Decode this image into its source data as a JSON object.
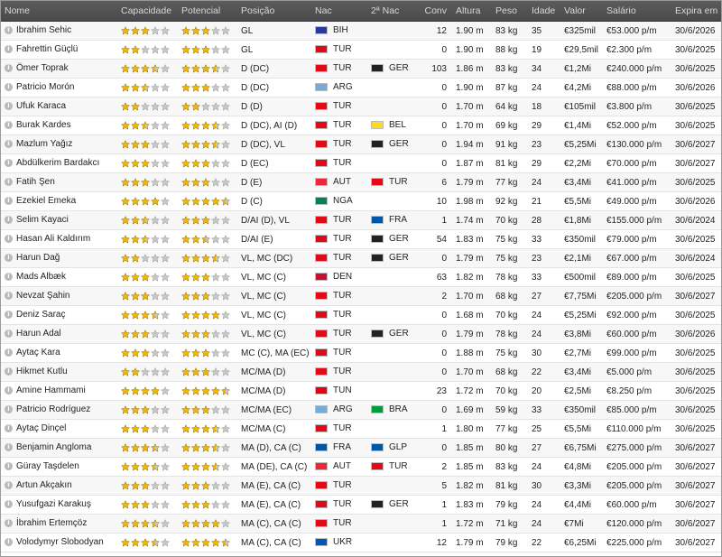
{
  "columns": {
    "nome": "Nome",
    "capacidade": "Capacidade",
    "potencial": "Potencial",
    "posicao": "Posição",
    "nac": "Nac",
    "nac2": "2ª Nac",
    "conv": "Conv",
    "altura": "Altura",
    "peso": "Peso",
    "idade": "Idade",
    "valor": "Valor",
    "salario": "Salário",
    "expira": "Expira em"
  },
  "flag_colors": {
    "BIH": "#2a3a9c",
    "TUR": "#e30a17",
    "GER": "#222222",
    "ARG": "#75aadb",
    "BEL": "#fdda24",
    "AUT": "#ed2939",
    "NGA": "#008751",
    "FRA": "#0055a4",
    "DEN": "#c8102e",
    "TUN": "#e70013",
    "BRA": "#009c3b",
    "GLP": "#0055a4",
    "UKR": "#0057b7"
  },
  "star_colors": {
    "full": "#f2b705",
    "empty": "#c7c7c7",
    "outline": "#8f6b00"
  },
  "players": [
    {
      "name": "Ibrahim Sehic",
      "cap": 3,
      "pot": 3,
      "pos": "GL",
      "nac": "BIH",
      "nac2": "",
      "conv": "12",
      "alt": "1.90 m",
      "peso": "83 kg",
      "idade": "35",
      "valor": "€325mil",
      "salario": "€53.000 p/m",
      "expira": "30/6/2026"
    },
    {
      "name": "Fahrettin Güçlü",
      "cap": 2,
      "pot": 3,
      "pos": "GL",
      "nac": "TUR",
      "nac2": "",
      "conv": "0",
      "alt": "1.90 m",
      "peso": "88 kg",
      "idade": "19",
      "valor": "€29,5mil",
      "salario": "€2.300 p/m",
      "expira": "30/6/2025"
    },
    {
      "name": "Ömer Toprak",
      "cap": 3.5,
      "pot": 3.5,
      "pos": "D (DC)",
      "nac": "TUR",
      "nac2": "GER",
      "conv": "103",
      "alt": "1.86 m",
      "peso": "83 kg",
      "idade": "34",
      "valor": "€1,2Mi",
      "salario": "€240.000 p/m",
      "expira": "30/6/2025"
    },
    {
      "name": "Patricio Morón",
      "cap": 2.5,
      "pot": 3,
      "pos": "D (DC)",
      "nac": "ARG",
      "nac2": "",
      "conv": "0",
      "alt": "1.90 m",
      "peso": "87 kg",
      "idade": "24",
      "valor": "€4,2Mi",
      "salario": "€88.000 p/m",
      "expira": "30/6/2026"
    },
    {
      "name": "Ufuk Karaca",
      "cap": 2,
      "pot": 2,
      "pos": "D (D)",
      "nac": "TUR",
      "nac2": "",
      "conv": "0",
      "alt": "1.70 m",
      "peso": "64 kg",
      "idade": "18",
      "valor": "€105mil",
      "salario": "€3.800 p/m",
      "expira": "30/6/2025"
    },
    {
      "name": "Burak Kardes",
      "cap": 2.5,
      "pot": 3.5,
      "pos": "D (DC), AI (D)",
      "nac": "TUR",
      "nac2": "BEL",
      "conv": "0",
      "alt": "1.70 m",
      "peso": "69 kg",
      "idade": "29",
      "valor": "€1,4Mi",
      "salario": "€52.000 p/m",
      "expira": "30/6/2025"
    },
    {
      "name": "Mazlum Yağız",
      "cap": 3,
      "pot": 3.5,
      "pos": "D (DC), VL",
      "nac": "TUR",
      "nac2": "GER",
      "conv": "0",
      "alt": "1.94 m",
      "peso": "91 kg",
      "idade": "23",
      "valor": "€5,25Mi",
      "salario": "€130.000 p/m",
      "expira": "30/6/2027"
    },
    {
      "name": "Abdülkerim Bardakcı",
      "cap": 3,
      "pot": 3,
      "pos": "D (EC)",
      "nac": "TUR",
      "nac2": "",
      "conv": "0",
      "alt": "1.87 m",
      "peso": "81 kg",
      "idade": "29",
      "valor": "€2,2Mi",
      "salario": "€70.000 p/m",
      "expira": "30/6/2027"
    },
    {
      "name": "Fatih Şen",
      "cap": 3,
      "pot": 3,
      "pos": "D (E)",
      "nac": "AUT",
      "nac2": "TUR",
      "conv": "6",
      "alt": "1.79 m",
      "peso": "77 kg",
      "idade": "24",
      "valor": "€3,4Mi",
      "salario": "€41.000 p/m",
      "expira": "30/6/2025"
    },
    {
      "name": "Ezekiel Emeka",
      "cap": 4,
      "pot": 4.5,
      "pos": "D (C)",
      "nac": "NGA",
      "nac2": "",
      "conv": "10",
      "alt": "1.98 m",
      "peso": "92 kg",
      "idade": "21",
      "valor": "€5,5Mi",
      "salario": "€49.000 p/m",
      "expira": "30/6/2026"
    },
    {
      "name": "Selim Kayaci",
      "cap": 2.5,
      "pot": 3,
      "pos": "D/AI (D), VL",
      "nac": "TUR",
      "nac2": "FRA",
      "conv": "1",
      "alt": "1.74 m",
      "peso": "70 kg",
      "idade": "28",
      "valor": "€1,8Mi",
      "salario": "€155.000 p/m",
      "expira": "30/6/2024"
    },
    {
      "name": "Hasan Ali Kaldırım",
      "cap": 2.5,
      "pot": 2.5,
      "pos": "D/AI (E)",
      "nac": "TUR",
      "nac2": "GER",
      "conv": "54",
      "alt": "1.83 m",
      "peso": "75 kg",
      "idade": "33",
      "valor": "€350mil",
      "salario": "€79.000 p/m",
      "expira": "30/6/2025"
    },
    {
      "name": "Harun Dağ",
      "cap": 2,
      "pot": 3.5,
      "pos": "VL, MC (DC)",
      "nac": "TUR",
      "nac2": "GER",
      "conv": "0",
      "alt": "1.79 m",
      "peso": "75 kg",
      "idade": "23",
      "valor": "€2,1Mi",
      "salario": "€67.000 p/m",
      "expira": "30/6/2024"
    },
    {
      "name": "Mads Albæk",
      "cap": 3,
      "pot": 3,
      "pos": "VL, MC (C)",
      "nac": "DEN",
      "nac2": "",
      "conv": "63",
      "alt": "1.82 m",
      "peso": "78 kg",
      "idade": "33",
      "valor": "€500mil",
      "salario": "€89.000 p/m",
      "expira": "30/6/2025"
    },
    {
      "name": "Nevzat Şahin",
      "cap": 3,
      "pot": 3,
      "pos": "VL, MC (C)",
      "nac": "TUR",
      "nac2": "",
      "conv": "2",
      "alt": "1.70 m",
      "peso": "68 kg",
      "idade": "27",
      "valor": "€7,75Mi",
      "salario": "€205.000 p/m",
      "expira": "30/6/2027"
    },
    {
      "name": "Deniz Saraç",
      "cap": 3.5,
      "pot": 4,
      "pos": "VL, MC (C)",
      "nac": "TUR",
      "nac2": "",
      "conv": "0",
      "alt": "1.68 m",
      "peso": "70 kg",
      "idade": "24",
      "valor": "€5,25Mi",
      "salario": "€92.000 p/m",
      "expira": "30/6/2025"
    },
    {
      "name": "Harun Adal",
      "cap": 3,
      "pot": 3,
      "pos": "VL, MC (C)",
      "nac": "TUR",
      "nac2": "GER",
      "conv": "0",
      "alt": "1.79 m",
      "peso": "78 kg",
      "idade": "24",
      "valor": "€3,8Mi",
      "salario": "€60.000 p/m",
      "expira": "30/6/2026"
    },
    {
      "name": "Aytaç Kara",
      "cap": 3,
      "pot": 3,
      "pos": "MC (C), MA (EC)",
      "nac": "TUR",
      "nac2": "",
      "conv": "0",
      "alt": "1.88 m",
      "peso": "75 kg",
      "idade": "30",
      "valor": "€2,7Mi",
      "salario": "€99.000 p/m",
      "expira": "30/6/2025"
    },
    {
      "name": "Hikmet Kutlu",
      "cap": 2,
      "pot": 3,
      "pos": "MC/MA (D)",
      "nac": "TUR",
      "nac2": "",
      "conv": "0",
      "alt": "1.70 m",
      "peso": "68 kg",
      "idade": "22",
      "valor": "€3,4Mi",
      "salario": "€5.000 p/m",
      "expira": "30/6/2025"
    },
    {
      "name": "Amine Hammami",
      "cap": 4,
      "pot": 4.5,
      "pos": "MC/MA (D)",
      "nac": "TUN",
      "nac2": "",
      "conv": "23",
      "alt": "1.72 m",
      "peso": "70 kg",
      "idade": "20",
      "valor": "€2,5Mi",
      "salario": "€8.250 p/m",
      "expira": "30/6/2025"
    },
    {
      "name": "Patricio Rodríguez",
      "cap": 3,
      "pot": 3,
      "pos": "MC/MA (EC)",
      "nac": "ARG",
      "nac2": "BRA",
      "conv": "0",
      "alt": "1.69 m",
      "peso": "59 kg",
      "idade": "33",
      "valor": "€350mil",
      "salario": "€85.000 p/m",
      "expira": "30/6/2025"
    },
    {
      "name": "Aytaç Dinçel",
      "cap": 3,
      "pot": 3.5,
      "pos": "MC/MA (C)",
      "nac": "TUR",
      "nac2": "",
      "conv": "1",
      "alt": "1.80 m",
      "peso": "77 kg",
      "idade": "25",
      "valor": "€5,5Mi",
      "salario": "€110.000 p/m",
      "expira": "30/6/2025"
    },
    {
      "name": "Benjamin Angloma",
      "cap": 3.5,
      "pot": 3.5,
      "pos": "MA (D), CA (C)",
      "nac": "FRA",
      "nac2": "GLP",
      "conv": "0",
      "alt": "1.85 m",
      "peso": "80 kg",
      "idade": "27",
      "valor": "€6,75Mi",
      "salario": "€275.000 p/m",
      "expira": "30/6/2027"
    },
    {
      "name": "Güray Taşdelen",
      "cap": 3.5,
      "pot": 3.5,
      "pos": "MA (DE), CA (C)",
      "nac": "AUT",
      "nac2": "TUR",
      "conv": "2",
      "alt": "1.85 m",
      "peso": "83 kg",
      "idade": "24",
      "valor": "€4,8Mi",
      "salario": "€205.000 p/m",
      "expira": "30/6/2027"
    },
    {
      "name": "Artun Akçakın",
      "cap": 3,
      "pot": 3,
      "pos": "MA (E), CA (C)",
      "nac": "TUR",
      "nac2": "",
      "conv": "5",
      "alt": "1.82 m",
      "peso": "81 kg",
      "idade": "30",
      "valor": "€3,3Mi",
      "salario": "€205.000 p/m",
      "expira": "30/6/2027"
    },
    {
      "name": "Yusufgazi Karakuş",
      "cap": 3,
      "pot": 3,
      "pos": "MA (E), CA (C)",
      "nac": "TUR",
      "nac2": "GER",
      "conv": "1",
      "alt": "1.83 m",
      "peso": "79 kg",
      "idade": "24",
      "valor": "€4,4Mi",
      "salario": "€60.000 p/m",
      "expira": "30/6/2027"
    },
    {
      "name": "İbrahim Ertemçöz",
      "cap": 3.5,
      "pot": 4,
      "pos": "MA (C), CA (C)",
      "nac": "TUR",
      "nac2": "",
      "conv": "1",
      "alt": "1.72 m",
      "peso": "71 kg",
      "idade": "24",
      "valor": "€7Mi",
      "salario": "€120.000 p/m",
      "expira": "30/6/2027"
    },
    {
      "name": "Volodymyr Slobodyan",
      "cap": 3.5,
      "pot": 4.5,
      "pos": "MA (C), CA (C)",
      "nac": "UKR",
      "nac2": "",
      "conv": "12",
      "alt": "1.79 m",
      "peso": "79 kg",
      "idade": "22",
      "valor": "€6,25Mi",
      "salario": "€225.000 p/m",
      "expira": "30/6/2027"
    }
  ]
}
